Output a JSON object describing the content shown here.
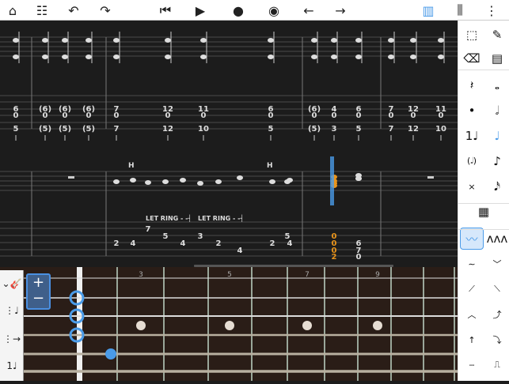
{
  "toolbar": {
    "items": [
      {
        "name": "home-icon",
        "glyph": "⌂"
      },
      {
        "name": "track-list-icon",
        "glyph": "☷"
      },
      {
        "name": "undo-icon",
        "glyph": "↶"
      },
      {
        "name": "redo-icon",
        "glyph": "↷"
      },
      {
        "name": "skip-back-icon",
        "glyph": "⏮"
      },
      {
        "name": "play-icon",
        "glyph": "▶"
      },
      {
        "name": "record-icon",
        "glyph": "●"
      },
      {
        "name": "metronome-icon",
        "glyph": "◉"
      },
      {
        "name": "arrow-left-icon",
        "glyph": "←"
      },
      {
        "name": "arrow-right-icon",
        "glyph": "→"
      },
      {
        "name": "piano-icon",
        "glyph": "▥"
      },
      {
        "name": "mixer-icon",
        "glyph": "⫼"
      },
      {
        "name": "more-icon",
        "glyph": "⋮"
      }
    ]
  },
  "accent": "#4a9be8",
  "selection_color": "#e8941c",
  "right_panel": {
    "tools": [
      {
        "name": "select-icon",
        "glyph": "⬚"
      },
      {
        "name": "pencil-icon",
        "glyph": "✎"
      },
      {
        "name": "eraser-icon",
        "glyph": "⌫"
      },
      {
        "name": "note-settings-icon",
        "glyph": "▤"
      },
      {
        "name": "rest-icon",
        "glyph": "𝄽"
      },
      {
        "name": "whole-note-icon",
        "glyph": "𝅝"
      },
      {
        "name": "dot-icon",
        "glyph": "•"
      },
      {
        "name": "half-note-icon",
        "glyph": "𝅗𝅥"
      },
      {
        "name": "tuplet-icon",
        "glyph": "1♩"
      },
      {
        "name": "quarter-note-icon",
        "glyph": "♩"
      },
      {
        "name": "ghost-note-icon",
        "glyph": "(𝅗𝅥)"
      },
      {
        "name": "eighth-note-icon",
        "glyph": "♪"
      },
      {
        "name": "dead-note-icon",
        "glyph": "×"
      },
      {
        "name": "sixteenth-note-icon",
        "glyph": "𝅘𝅥𝅯"
      },
      {
        "name": "keypad-icon",
        "glyph": "▦"
      },
      {
        "name": "vibrato-icon",
        "glyph": "〰"
      },
      {
        "name": "wide-vibrato-icon",
        "glyph": "ʌʌʌ"
      },
      {
        "name": "trill-icon",
        "glyph": "∼"
      },
      {
        "name": "bend-down-icon",
        "glyph": "﹀"
      },
      {
        "name": "slide-up-icon",
        "glyph": "⟋"
      },
      {
        "name": "slide-down-icon",
        "glyph": "⟍"
      },
      {
        "name": "bend-icon",
        "glyph": "︿"
      },
      {
        "name": "bend-release-icon",
        "glyph": "⤴"
      },
      {
        "name": "pick-up-icon",
        "glyph": "↑"
      },
      {
        "name": "slide-out-icon",
        "glyph": "⤵"
      },
      {
        "name": "let-ring-icon",
        "glyph": "┄"
      },
      {
        "name": "tapping-icon",
        "glyph": "⎍"
      }
    ]
  },
  "tab1": [
    {
      "col": 20,
      "notes": [
        "6",
        "0",
        "5"
      ]
    },
    {
      "col": 57,
      "notes": [
        "(6)",
        "0",
        "(5)"
      ]
    },
    {
      "col": 82,
      "notes": [
        "(6)",
        "0",
        "(5)"
      ]
    },
    {
      "col": 112,
      "notes": [
        "(6)",
        "0",
        "(5)"
      ]
    },
    {
      "col": 147,
      "notes": [
        "7",
        "0",
        "7"
      ]
    },
    {
      "col": 212,
      "notes": [
        "12",
        "0",
        "12"
      ]
    },
    {
      "col": 257,
      "notes": [
        "11",
        "0",
        "10"
      ]
    },
    {
      "col": 342,
      "notes": [
        "6",
        "0",
        "5"
      ]
    },
    {
      "col": 397,
      "notes": [
        "(6)",
        "0",
        "(5)"
      ]
    },
    {
      "col": 422,
      "notes": [
        "4",
        "0",
        "3"
      ]
    },
    {
      "col": 453,
      "notes": [
        "6",
        "0",
        "5"
      ]
    },
    {
      "col": 494,
      "notes": [
        "7",
        "0",
        "7"
      ]
    },
    {
      "col": 522,
      "notes": [
        "12",
        "0",
        "12"
      ]
    },
    {
      "col": 557,
      "notes": [
        "11",
        "0",
        "10"
      ]
    }
  ],
  "tab2": [
    {
      "col": 147,
      "str": 3,
      "fret": "2"
    },
    {
      "col": 168,
      "str": 3,
      "fret": "4"
    },
    {
      "col": 187,
      "str": 1,
      "fret": "7"
    },
    {
      "col": 209,
      "str": 2,
      "fret": "5"
    },
    {
      "col": 231,
      "str": 3,
      "fret": "4"
    },
    {
      "col": 253,
      "str": 2,
      "fret": "3"
    },
    {
      "col": 276,
      "str": 3,
      "fret": "2"
    },
    {
      "col": 303,
      "str": 4,
      "fret": "4"
    },
    {
      "col": 344,
      "str": 3,
      "fret": "2"
    },
    {
      "col": 363,
      "str": 2,
      "fret": "5"
    },
    {
      "col": 366,
      "str": 3,
      "fret": "4"
    },
    {
      "col": 422,
      "str": 2,
      "fret": "0",
      "sel": true
    },
    {
      "col": 422,
      "str": 3,
      "fret": "0",
      "sel": true
    },
    {
      "col": 422,
      "str": 4,
      "fret": "0",
      "sel": true
    },
    {
      "col": 422,
      "str": 5,
      "fret": "2",
      "sel": true
    },
    {
      "col": 453,
      "str": 3,
      "fret": "6"
    },
    {
      "col": 453,
      "str": 4,
      "fret": "7"
    },
    {
      "col": 453,
      "str": 5,
      "fret": "0"
    }
  ],
  "let_ring": [
    "LET RING",
    "LET RING"
  ],
  "hammer": [
    "H",
    "H"
  ],
  "fretboard": {
    "fret_numbers": [
      "3",
      "5",
      "7",
      "9"
    ],
    "zoom_in": "+",
    "zoom_out": "−"
  }
}
